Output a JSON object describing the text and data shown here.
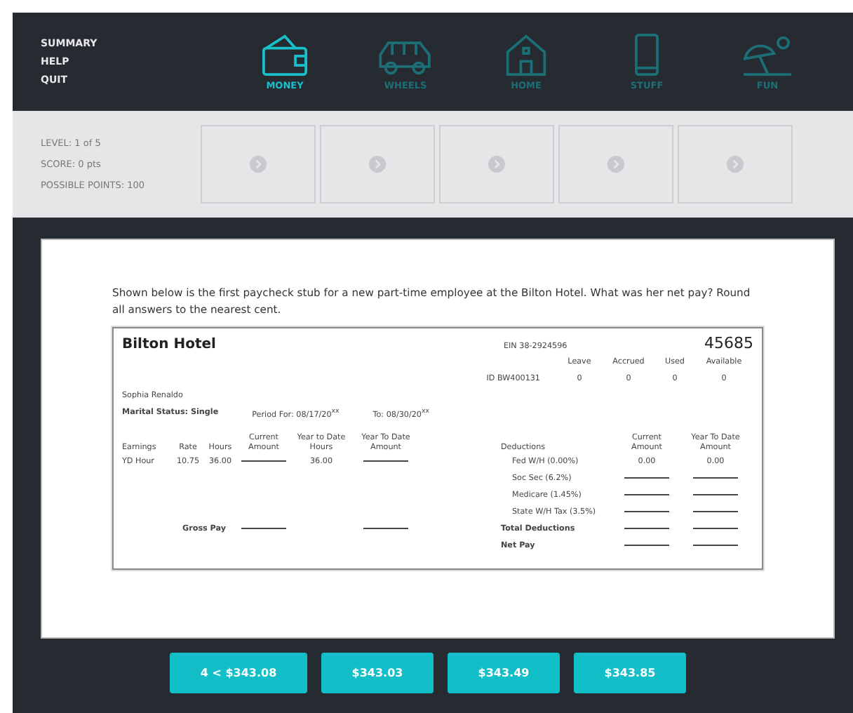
{
  "menu": [
    "SUMMARY",
    "HELP",
    "QUIT"
  ],
  "nav": [
    {
      "label": "MONEY",
      "selected": true
    },
    {
      "label": "WHEELS",
      "selected": false
    },
    {
      "label": "HOME",
      "selected": false
    },
    {
      "label": "STUFF",
      "selected": false
    },
    {
      "label": "FUN",
      "selected": false
    }
  ],
  "status": [
    "LEVEL: 1 of 5",
    "SCORE: 0 pts",
    "POSSIBLE POINTS: 100"
  ],
  "question": "Shown below is the first paycheck stub for a new part-time employee at the Bilton Hotel. What was her net pay? Round all answers to the nearest cent.",
  "stub": {
    "company": "Bilton Hotel",
    "ein": "EIN 38-2924596",
    "number": "45685",
    "leave_headers": [
      "Leave",
      "Accrued",
      "Used",
      "Available"
    ],
    "id": "ID BW400131",
    "leave_values": [
      "0",
      "0",
      "0",
      "0"
    ],
    "employee": "Sophia Renaldo",
    "marital_status": "Marital Status: Single",
    "period_for": "Period For: 08/17/20$^{xx}$",
    "period_to": "To: 08/30/20$^{xx}$",
    "earnings_headers": [
      "Earnings",
      "Rate",
      "Hours",
      "Current Amount",
      "Year to Date Hours",
      "Year To Date Amount"
    ],
    "earnings": [
      [
        {
          "kind": "value",
          "text": "YD Hour"
        },
        {
          "kind": "value",
          "text": "10.75"
        },
        {
          "kind": "value",
          "text": "36.00"
        },
        {
          "kind": "blank"
        },
        {
          "kind": "value",
          "text": "36.00"
        },
        {
          "kind": "blank"
        }
      ]
    ],
    "gross_pay": {
      "label": "Gross Pay",
      "current": {
        "kind": "blank"
      },
      "ytd": {
        "kind": "blank"
      }
    },
    "deduction_headers": [
      "Deductions",
      "Current Amount",
      "Year To Date Amount"
    ],
    "deductions": [
      {
        "kind": "item",
        "label": "Fed W/H (0.00%)",
        "current": {
          "kind": "value",
          "text": "0.00"
        },
        "ytd": {
          "kind": "value",
          "text": "0.00"
        }
      },
      {
        "kind": "item",
        "label": "Soc Sec (6.2%)",
        "current": {
          "kind": "blank"
        },
        "ytd": {
          "kind": "blank"
        }
      },
      {
        "kind": "item",
        "label": "Medicare (1.45%)",
        "current": {
          "kind": "blank"
        },
        "ytd": {
          "kind": "blank"
        }
      },
      {
        "kind": "item",
        "label": "State W/H Tax (3.5%)",
        "current": {
          "kind": "blank"
        },
        "ytd": {
          "kind": "blank"
        }
      },
      {
        "kind": "total",
        "label": "Total Deductions",
        "current": {
          "kind": "blank"
        },
        "ytd": {
          "kind": "blank"
        }
      },
      {
        "kind": "total",
        "label": "Net Pay",
        "current": {
          "kind": "blank"
        },
        "ytd": {
          "kind": "blank"
        }
      }
    ]
  },
  "answers": [
    "4 < $343.08",
    "$343.03",
    "$343.49",
    "$343.85"
  ]
}
